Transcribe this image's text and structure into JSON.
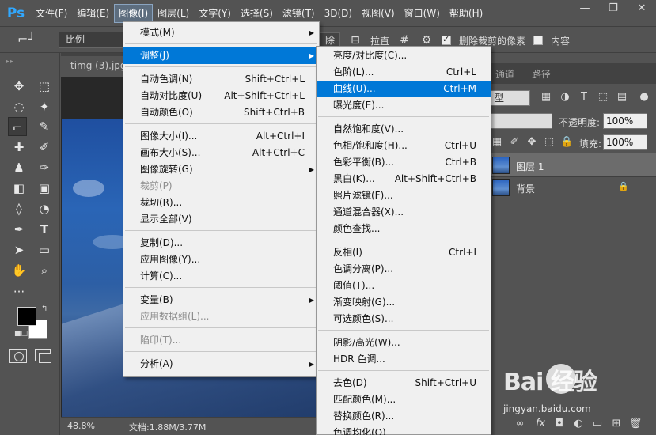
{
  "app": {
    "logo": "Ps"
  },
  "menubar": [
    {
      "label": "文件(F)"
    },
    {
      "label": "编辑(E)"
    },
    {
      "label": "图像(I)"
    },
    {
      "label": "图层(L)"
    },
    {
      "label": "文字(Y)"
    },
    {
      "label": "选择(S)"
    },
    {
      "label": "滤镜(T)"
    },
    {
      "label": "3D(D)"
    },
    {
      "label": "视图(V)"
    },
    {
      "label": "窗口(W)"
    },
    {
      "label": "帮助(H)"
    }
  ],
  "options": {
    "ratio_value": "比例",
    "clear_label": "除",
    "straighten_label": "拉直",
    "delete_cropped_label": "删除裁剪的像素",
    "content_aware_label": "内容"
  },
  "document": {
    "tab_title": "timg (3).jpg",
    "zoom": "48.8%",
    "doc_size": "文档:1.88M/3.77M"
  },
  "panels": {
    "tabs": [
      "通道",
      "路径"
    ],
    "kind_value": "型",
    "opacity_label": "不透明度:",
    "opacity_value": "100%",
    "fill_label": "填充:",
    "fill_value": "100%",
    "layers": [
      {
        "name": "图层 1"
      },
      {
        "name": "背景"
      }
    ]
  },
  "image_menu": [
    {
      "label": "模式(M)",
      "shortcut": "",
      "arrow": "▶"
    },
    {
      "label": "调整(J)",
      "shortcut": "",
      "arrow": "▶"
    },
    {
      "label": "自动色调(N)",
      "shortcut": "Shift+Ctrl+L",
      "arrow": ""
    },
    {
      "label": "自动对比度(U)",
      "shortcut": "Alt+Shift+Ctrl+L",
      "arrow": ""
    },
    {
      "label": "自动颜色(O)",
      "shortcut": "Shift+Ctrl+B",
      "arrow": ""
    },
    {
      "label": "图像大小(I)...",
      "shortcut": "Alt+Ctrl+I",
      "arrow": ""
    },
    {
      "label": "画布大小(S)...",
      "shortcut": "Alt+Ctrl+C",
      "arrow": ""
    },
    {
      "label": "图像旋转(G)",
      "shortcut": "",
      "arrow": "▶"
    },
    {
      "label": "裁剪(P)",
      "shortcut": "",
      "arrow": ""
    },
    {
      "label": "裁切(R)...",
      "shortcut": "",
      "arrow": ""
    },
    {
      "label": "显示全部(V)",
      "shortcut": "",
      "arrow": ""
    },
    {
      "label": "复制(D)...",
      "shortcut": "",
      "arrow": ""
    },
    {
      "label": "应用图像(Y)...",
      "shortcut": "",
      "arrow": ""
    },
    {
      "label": "计算(C)...",
      "shortcut": "",
      "arrow": ""
    },
    {
      "label": "变量(B)",
      "shortcut": "",
      "arrow": "▶"
    },
    {
      "label": "应用数据组(L)...",
      "shortcut": "",
      "arrow": ""
    },
    {
      "label": "陷印(T)...",
      "shortcut": "",
      "arrow": ""
    },
    {
      "label": "分析(A)",
      "shortcut": "",
      "arrow": "▶"
    }
  ],
  "adjust_menu": [
    {
      "label": "亮度/对比度(C)...",
      "shortcut": ""
    },
    {
      "label": "色阶(L)...",
      "shortcut": "Ctrl+L"
    },
    {
      "label": "曲线(U)...",
      "shortcut": "Ctrl+M"
    },
    {
      "label": "曝光度(E)...",
      "shortcut": ""
    },
    {
      "label": "自然饱和度(V)...",
      "shortcut": ""
    },
    {
      "label": "色相/饱和度(H)...",
      "shortcut": "Ctrl+U"
    },
    {
      "label": "色彩平衡(B)...",
      "shortcut": "Ctrl+B"
    },
    {
      "label": "黑白(K)...",
      "shortcut": "Alt+Shift+Ctrl+B"
    },
    {
      "label": "照片滤镜(F)...",
      "shortcut": ""
    },
    {
      "label": "通道混合器(X)...",
      "shortcut": ""
    },
    {
      "label": "颜色查找...",
      "shortcut": ""
    },
    {
      "label": "反相(I)",
      "shortcut": "Ctrl+I"
    },
    {
      "label": "色调分离(P)...",
      "shortcut": ""
    },
    {
      "label": "阈值(T)...",
      "shortcut": ""
    },
    {
      "label": "渐变映射(G)...",
      "shortcut": ""
    },
    {
      "label": "可选颜色(S)...",
      "shortcut": ""
    },
    {
      "label": "阴影/高光(W)...",
      "shortcut": ""
    },
    {
      "label": "HDR 色调...",
      "shortcut": ""
    },
    {
      "label": "去色(D)",
      "shortcut": "Shift+Ctrl+U"
    },
    {
      "label": "匹配颜色(M)...",
      "shortcut": ""
    },
    {
      "label": "替换颜色(R)...",
      "shortcut": ""
    },
    {
      "label": "色调均化(Q)",
      "shortcut": ""
    }
  ],
  "watermark": {
    "logo": "Bai  经验",
    "url": "jingyan.baidu.com"
  }
}
